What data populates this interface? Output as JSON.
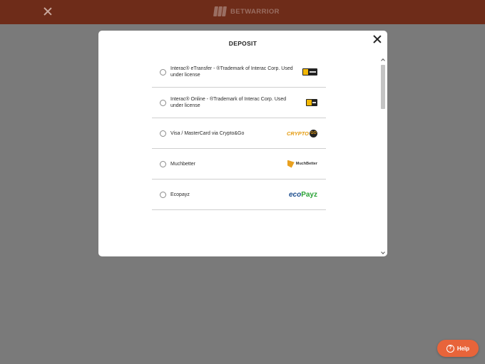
{
  "header": {
    "brand_name": "BETWARRIOR",
    "close_icon": "close-icon",
    "background_color": "#6e2c19"
  },
  "modal": {
    "title": "DEPOSIT",
    "close_icon": "close-icon",
    "methods": [
      {
        "label": "Interac® eTransfer - ®Trademark of Interac Corp. Used under license",
        "logo": "interac-etransfer-logo",
        "selected": false
      },
      {
        "label": "Interac® Online - ®Trademark of Interac Corp. Used under license",
        "logo": "interac-online-logo",
        "selected": false
      },
      {
        "label": "Visa / MasterCard via Crypto&Go",
        "logo": "crypto-and-go-logo",
        "logo_text": "CRYPTO",
        "logo_badge": "GO",
        "selected": false
      },
      {
        "label": "Muchbetter",
        "logo": "muchbetter-logo",
        "logo_text": "MuchBetter",
        "selected": false
      },
      {
        "label": "Ecopayz",
        "logo": "ecopayz-logo",
        "logo_text_a": "eco",
        "logo_text_b": "Payz",
        "selected": false
      }
    ]
  },
  "help": {
    "label": "Help",
    "icon": "question-icon",
    "icon_glyph": "?",
    "color": "#e8643a"
  }
}
